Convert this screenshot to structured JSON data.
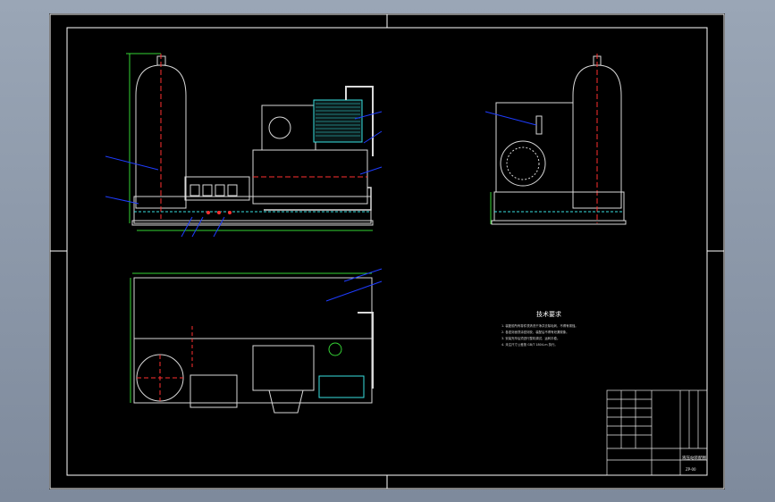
{
  "drawing": {
    "background": "#000000",
    "frame_color": "#ffffff",
    "outline_color": "#d9d9d9",
    "accent_blue": "#1e3cff",
    "accent_green": "#35d435",
    "accent_red": "#ff3030",
    "accent_cyan": "#38e0e0",
    "accent_yellow": "#f0e040"
  },
  "tech_requirements": {
    "title": "技术要求",
    "lines": [
      "1. 装配前所有零件须清洗干净并去除毛刺，不得有锈蚀。",
      "2. 各密封面须涂密封胶，装配后不得有泄漏现象。",
      "3. 安装完毕后须进行整机调试，运转平稳。",
      "4. 未注尺寸公差按 GB/T 1804-m 执行。"
    ]
  },
  "title_block": {
    "name": "液压站装配图",
    "code": "ZP-00"
  },
  "callouts": {
    "front_left": [
      "1",
      "2"
    ],
    "front_right": [
      "3",
      "4",
      "5"
    ],
    "front_bottom": [
      "6",
      "7",
      "8"
    ],
    "side": [
      "9"
    ],
    "top": [
      "10",
      "11"
    ]
  }
}
